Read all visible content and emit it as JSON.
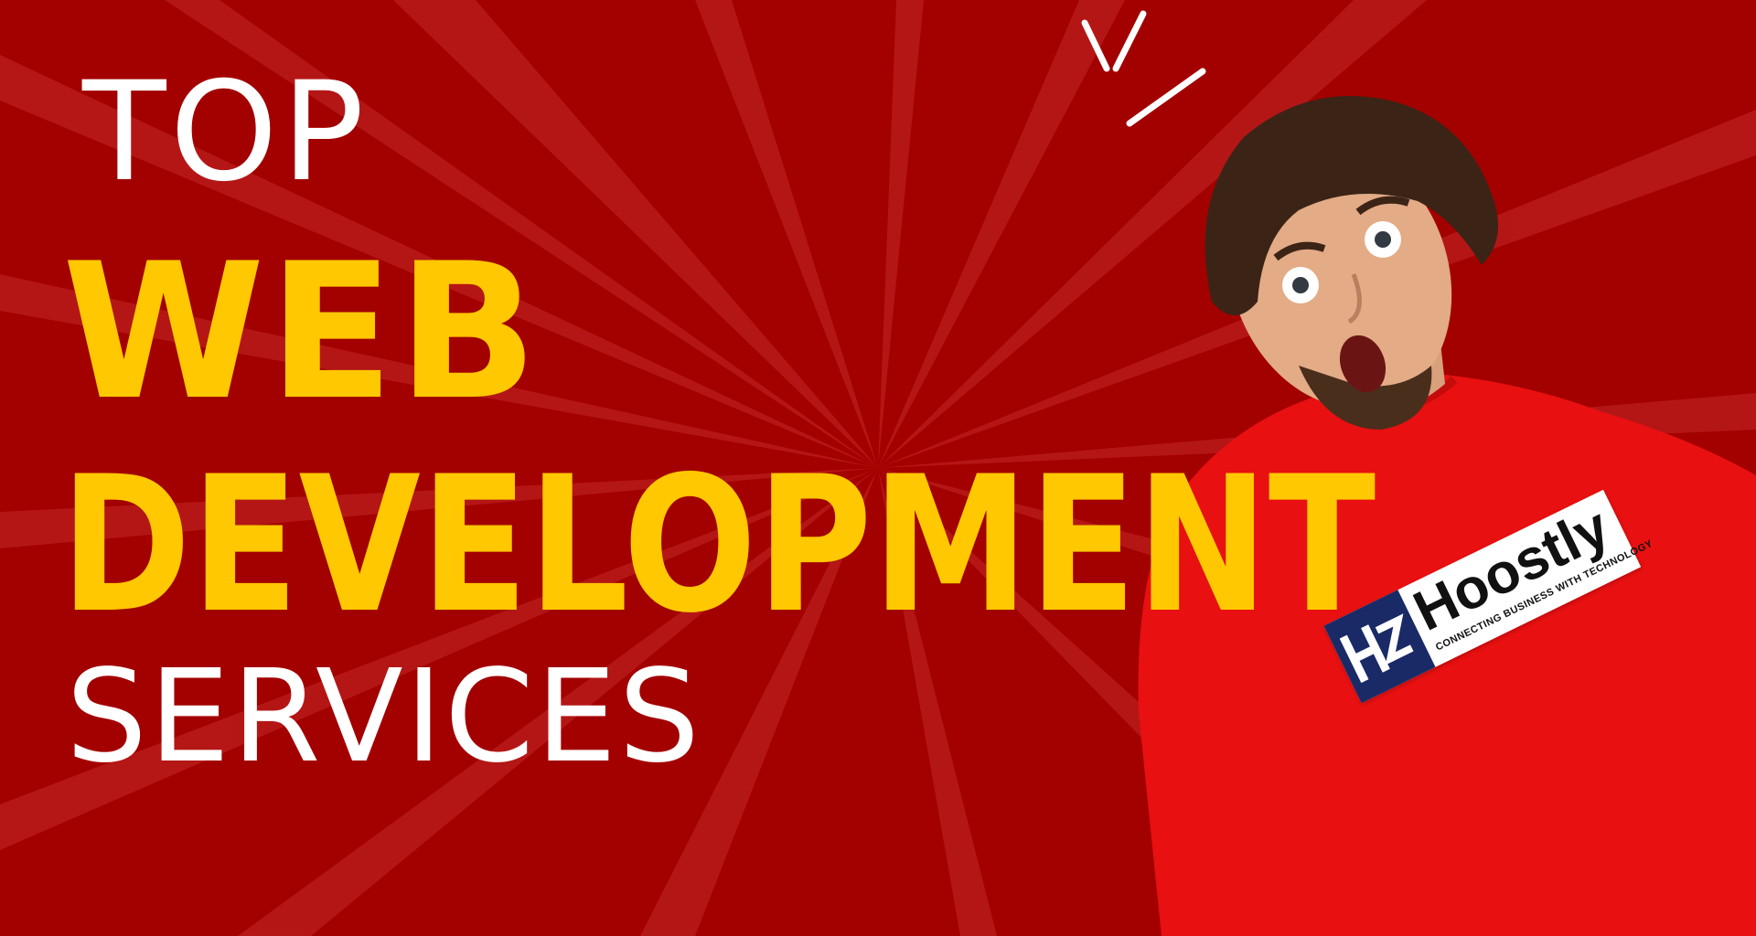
{
  "headline": {
    "line1": "TOP",
    "line2": "WEB",
    "line3": "DEVELOPMENT",
    "line4": "SERVICES"
  },
  "logo": {
    "wordmark": "Hoostly",
    "tagline": "CONNECTING BUSINESS WITH TECHNOLOGY"
  },
  "colors": {
    "background": "#a30000",
    "accent_yellow": "#ffc800",
    "text_white": "#ffffff",
    "shirt_red": "#e81010",
    "logo_navy": "#1a2a66"
  }
}
